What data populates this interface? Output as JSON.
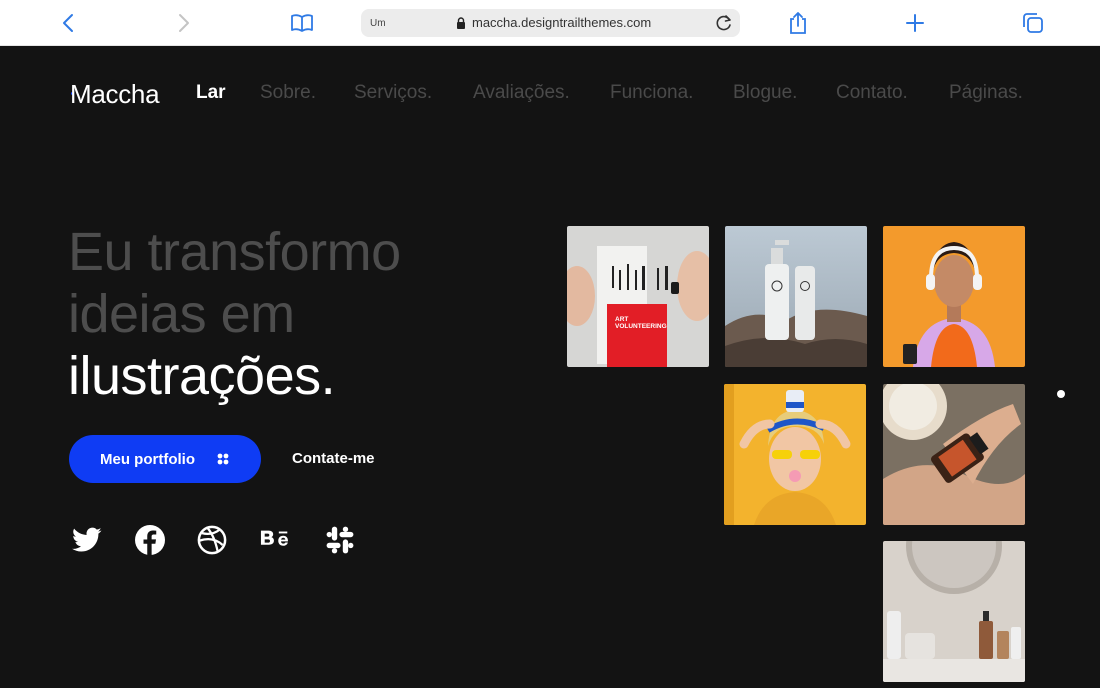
{
  "browser": {
    "address_tag": "Um",
    "url": "maccha.designtrailthemes.com",
    "icons": [
      "back-icon",
      "forward-icon",
      "book-icon",
      "lock-icon",
      "reload-icon",
      "share-icon",
      "plus-icon",
      "tabs-icon"
    ]
  },
  "site": {
    "logo": "Maccha",
    "nav": [
      "Lar",
      "Sobre.",
      "Serviços.",
      "Avaliações.",
      "Funciona.",
      "Blogue.",
      "Contato.",
      "Páginas."
    ],
    "active_nav": "Lar"
  },
  "hero": {
    "line1": "Eu transformo",
    "line2": "ideias em",
    "line3": "ilustrações.",
    "primary_button": "Meu portfolio",
    "secondary_button": "Contate-me"
  },
  "social_icons": [
    "twitter-icon",
    "facebook-icon",
    "dribbble-icon",
    "behance-icon",
    "slack-icon"
  ],
  "gallery": {
    "card1_text1": "ART",
    "card1_text2": "VOLUNTEERING"
  },
  "colors": {
    "accent": "#0f3cf4",
    "background": "#131313",
    "nav_dim": "#4a4a4a",
    "title_dim": "#4d4d4d"
  }
}
